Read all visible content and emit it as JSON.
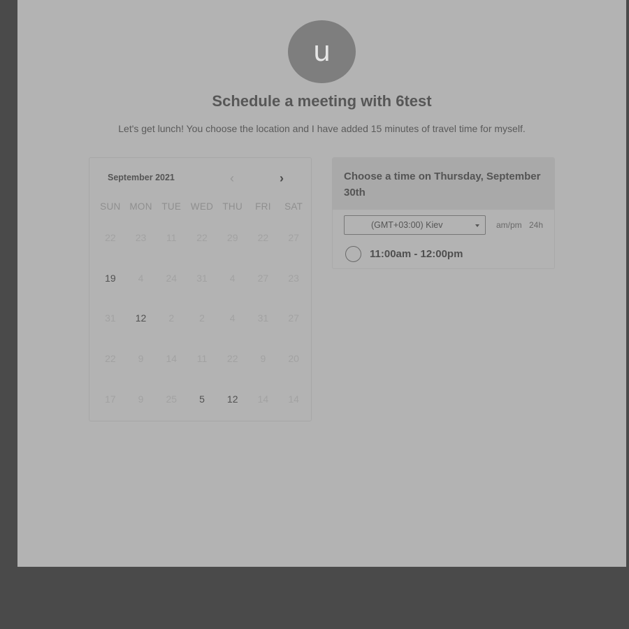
{
  "avatar": {
    "initial": "u"
  },
  "header": {
    "title": "Schedule a meeting with 6test",
    "subtitle": "Let's get lunch! You choose the location and I have added 15 minutes of travel time for myself."
  },
  "calendar": {
    "month_label": "September 2021",
    "weekdays": [
      "SUN",
      "MON",
      "TUE",
      "WED",
      "THU",
      "FRI",
      "SAT"
    ],
    "days": [
      {
        "label": "22",
        "available": false
      },
      {
        "label": "23",
        "available": false
      },
      {
        "label": "11",
        "available": false
      },
      {
        "label": "22",
        "available": false
      },
      {
        "label": "29",
        "available": false
      },
      {
        "label": "22",
        "available": false
      },
      {
        "label": "27",
        "available": false
      },
      {
        "label": "19",
        "available": true
      },
      {
        "label": "4",
        "available": false
      },
      {
        "label": "24",
        "available": false
      },
      {
        "label": "31",
        "available": false
      },
      {
        "label": "4",
        "available": false
      },
      {
        "label": "27",
        "available": false
      },
      {
        "label": "23",
        "available": false
      },
      {
        "label": "31",
        "available": false
      },
      {
        "label": "12",
        "available": true
      },
      {
        "label": "2",
        "available": false
      },
      {
        "label": "2",
        "available": false
      },
      {
        "label": "4",
        "available": false
      },
      {
        "label": "31",
        "available": false
      },
      {
        "label": "27",
        "available": false
      },
      {
        "label": "22",
        "available": false
      },
      {
        "label": "9",
        "available": false
      },
      {
        "label": "14",
        "available": false
      },
      {
        "label": "11",
        "available": false
      },
      {
        "label": "22",
        "available": false
      },
      {
        "label": "9",
        "available": false
      },
      {
        "label": "20",
        "available": false
      },
      {
        "label": "17",
        "available": false
      },
      {
        "label": "9",
        "available": false
      },
      {
        "label": "25",
        "available": false
      },
      {
        "label": "5",
        "available": true
      },
      {
        "label": "12",
        "available": true
      },
      {
        "label": "14",
        "available": false
      },
      {
        "label": "14",
        "available": false
      }
    ]
  },
  "time_panel": {
    "heading": "Choose a time on Thursday, September 30th",
    "timezone": "(GMT+03:00) Kiev",
    "format_ampm": "am/pm",
    "format_24h": "24h",
    "slots": [
      "11:00am - 12:00pm"
    ]
  },
  "icons": {
    "prev": "chevron-left-icon",
    "next": "chevron-right-icon",
    "dropdown": "caret-down-icon"
  }
}
